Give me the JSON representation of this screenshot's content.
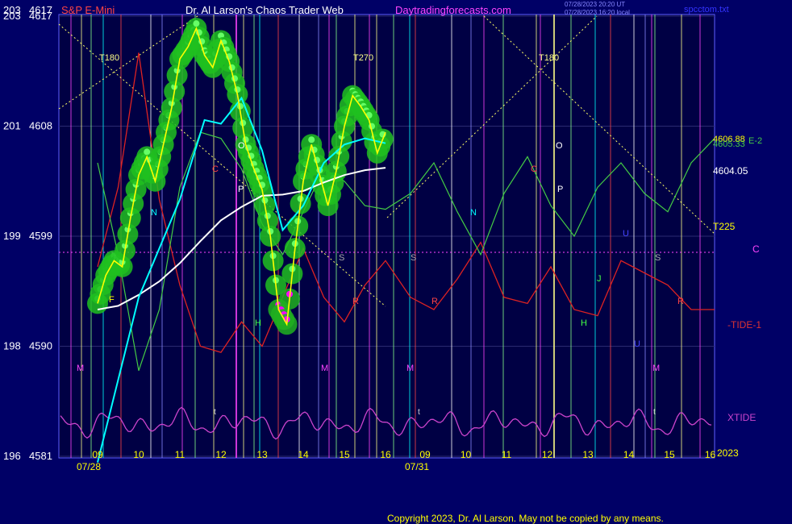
{
  "colors": {
    "background": "#000066",
    "plot_bg": "#000044",
    "frame": "#6060ff",
    "price": "#ffff00",
    "bubble": "#20c020",
    "bubble_low": "#ff00ff",
    "ma_short": "#00ffff",
    "ma_long": "#ffffff",
    "tide": "#dd2222",
    "e2": "#44cc44",
    "xtide": "#cc44cc",
    "header_title": "#ff4444",
    "header_link": "#ff44ff"
  },
  "header": {
    "left_code": "203",
    "left_price": "4617",
    "symbol": "S&P E-Mini",
    "site": "Dr. Al Larson's Chaos Trader Web",
    "link": "Daytradingforecasts.com",
    "small_line1": "07/28/2023 20:20 UT",
    "small_line2": "07/28/2023 16:20 local",
    "file": "spcctom.txt"
  },
  "chart_data": {
    "type": "line",
    "title": "S&P E-Mini",
    "y_ticks": [
      {
        "code": "203",
        "price": "4617"
      },
      {
        "code": "201",
        "price": "4608"
      },
      {
        "code": "199",
        "price": "4599"
      },
      {
        "code": "198",
        "price": "4590"
      },
      {
        "code": "196",
        "price": "4581"
      }
    ],
    "ylim": [
      4581,
      4617
    ],
    "hours_day1": [
      "09",
      "10",
      "11",
      "12",
      "13",
      "14",
      "15",
      "16"
    ],
    "hours_day2": [
      "09",
      "10",
      "11",
      "12",
      "13",
      "14",
      "15",
      "16"
    ],
    "date_labels": [
      "07/28",
      "07/31"
    ],
    "year": "2023",
    "current_price": "4604.05",
    "tag_price_top": "4606.88",
    "tag_price_bottom": "4605.33",
    "series": [
      {
        "name": "S&P E-Mini",
        "x": [
          9.0,
          9.2,
          9.4,
          9.6,
          9.8,
          10.0,
          10.2,
          10.4,
          10.6,
          10.8,
          11.0,
          11.2,
          11.4,
          11.6,
          11.8,
          12.0,
          12.2,
          12.4,
          12.6,
          12.8,
          13.0,
          13.2,
          13.4,
          13.6,
          13.8,
          14.0,
          14.2,
          14.4,
          14.6,
          14.8,
          15.0,
          15.2,
          15.4,
          15.6,
          15.8,
          16.0
        ],
        "values": [
          4593.5,
          4595.8,
          4597.0,
          4596.5,
          4600.5,
          4604.0,
          4605.5,
          4603.5,
          4606.5,
          4609.5,
          4613.5,
          4614.5,
          4616.0,
          4613.8,
          4612.8,
          4615.0,
          4613.3,
          4610.6,
          4606.5,
          4604.5,
          4602.8,
          4599.0,
          4593.0,
          4591.8,
          4598.0,
          4603.5,
          4606.5,
          4604.0,
          4601.5,
          4604.3,
          4608.0,
          4610.5,
          4609.6,
          4608.5,
          4605.8,
          4607.5
        ]
      },
      {
        "name": "MA fast",
        "x": [
          9.0,
          10.0,
          11.0,
          11.6,
          12.0,
          12.5,
          13.0,
          13.5,
          14.0,
          14.5,
          15.0,
          15.5,
          16.0
        ],
        "values": [
          4580.5,
          4594.0,
          4602.0,
          4608.5,
          4608.2,
          4610.3,
          4606.0,
          4599.5,
          4601.5,
          4605.0,
          4606.5,
          4607.0,
          4606.6
        ]
      },
      {
        "name": "MA slow",
        "x": [
          9.0,
          9.5,
          10.0,
          10.5,
          11.0,
          11.5,
          12.0,
          12.5,
          13.0,
          13.5,
          14.0,
          14.5,
          15.0,
          15.5,
          16.0
        ],
        "values": [
          4593.0,
          4593.3,
          4594.2,
          4595.3,
          4596.8,
          4598.6,
          4600.3,
          4601.4,
          4602.3,
          4602.4,
          4602.7,
          4603.4,
          4604.0,
          4604.4,
          4604.6
        ]
      },
      {
        "name": "E-2",
        "x": [
          9.0,
          9.5,
          10.0,
          10.5,
          11.0,
          11.5,
          12.0,
          12.5,
          13.0,
          13.5,
          14.0,
          14.5,
          15.0,
          15.5,
          16.0,
          16.5,
          17.0,
          17.5,
          18.0,
          18.5,
          19.0,
          19.5,
          20.0,
          20.5,
          21.0,
          21.5,
          22.0,
          22.5,
          23.0
        ],
        "values": [
          4605.0,
          4597.5,
          4588.0,
          4593.0,
          4603.0,
          4607.5,
          4607.0,
          4604.5,
          4600.0,
          4597.5,
          4601.0,
          4604.5,
          4603.5,
          4601.5,
          4601.2,
          4602.5,
          4605.0,
          4601.0,
          4597.5,
          4602.5,
          4605.5,
          4601.5,
          4599.0,
          4603.0,
          4605.0,
          4602.5,
          4601.0,
          4605.0,
          4607.0
        ]
      },
      {
        "name": "TIDE-1",
        "x": [
          9.0,
          9.5,
          10.0,
          10.5,
          11.0,
          11.5,
          12.0,
          12.5,
          13.0,
          13.5,
          14.0,
          14.5,
          15.0,
          15.5,
          16.0,
          16.5,
          17.0,
          17.5,
          18.0,
          18.5,
          19.0,
          19.5,
          20.0,
          20.5,
          21.0,
          21.5,
          22.0,
          22.5,
          23.0
        ],
        "values": [
          4596.5,
          4603.0,
          4614.0,
          4602.0,
          4595.0,
          4590.0,
          4589.5,
          4592.0,
          4590.0,
          4594.0,
          4598.0,
          4594.0,
          4592.0,
          4595.0,
          4597.0,
          4594.0,
          4593.0,
          4595.5,
          4598.5,
          4594.0,
          4593.5,
          4596.5,
          4593.0,
          4592.5,
          4597.0,
          4596.0,
          4595.0,
          4593.0,
          4593.0
        ]
      }
    ],
    "annotations_left": {
      "T180": "T180",
      "T270": "T270",
      "O": "O",
      "P": "P",
      "C": "C",
      "N": "N",
      "S": "S",
      "R": "R",
      "H": "H",
      "M": "M",
      "t": "t",
      "F": "F"
    },
    "right_labels": {
      "e2": "E-2",
      "price": "4604.05",
      "t225": "T225",
      "c": "C",
      "tide": "-TIDE-1",
      "xtide": "XTIDE",
      "year": "2023"
    },
    "forecast_letters": {
      "T180": "T180",
      "O": "O",
      "P": "P",
      "C": "C",
      "N": "N",
      "S": "S",
      "R": "R",
      "H": "H",
      "J": "J",
      "U": "U",
      "M": "M",
      "t": "t"
    },
    "grid": true
  },
  "footer": {
    "copyright": "Copyright 2023, Dr. Al Larson. May not be copied by any means."
  }
}
